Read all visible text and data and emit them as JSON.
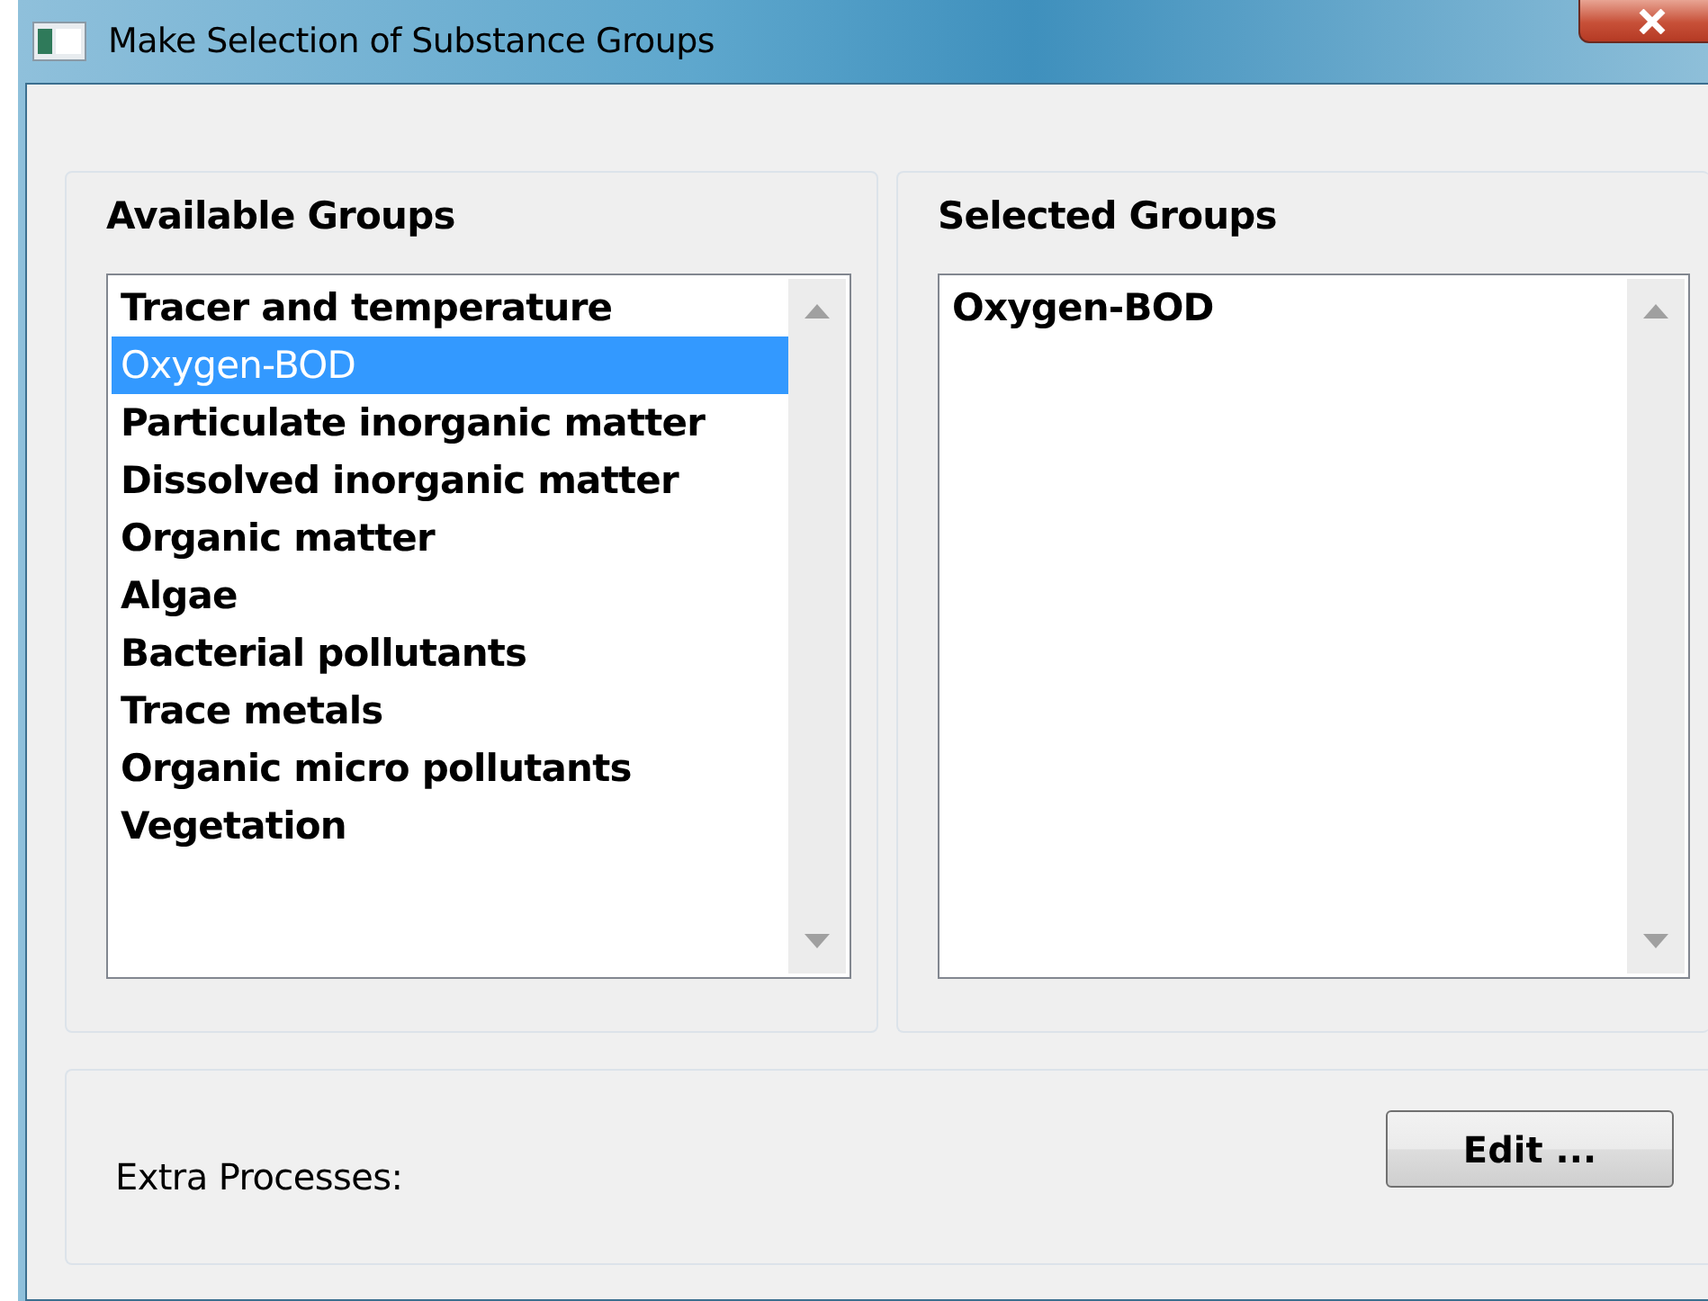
{
  "window": {
    "title": "Make Selection of Substance Groups"
  },
  "available_groups": {
    "heading": "Available Groups",
    "items": [
      {
        "label": "Tracer and temperature",
        "selected": false
      },
      {
        "label": "Oxygen-BOD",
        "selected": true
      },
      {
        "label": "Particulate inorganic matter",
        "selected": false
      },
      {
        "label": "Dissolved inorganic matter",
        "selected": false
      },
      {
        "label": "Organic matter",
        "selected": false
      },
      {
        "label": "Algae",
        "selected": false
      },
      {
        "label": "Bacterial pollutants",
        "selected": false
      },
      {
        "label": "Trace metals",
        "selected": false
      },
      {
        "label": "Organic micro pollutants",
        "selected": false
      },
      {
        "label": "Vegetation",
        "selected": false
      }
    ]
  },
  "selected_groups": {
    "heading": "Selected Groups",
    "items": [
      {
        "label": "Oxygen-BOD"
      }
    ]
  },
  "extra_processes": {
    "label": "Extra Processes:",
    "button": "Edit ..."
  }
}
